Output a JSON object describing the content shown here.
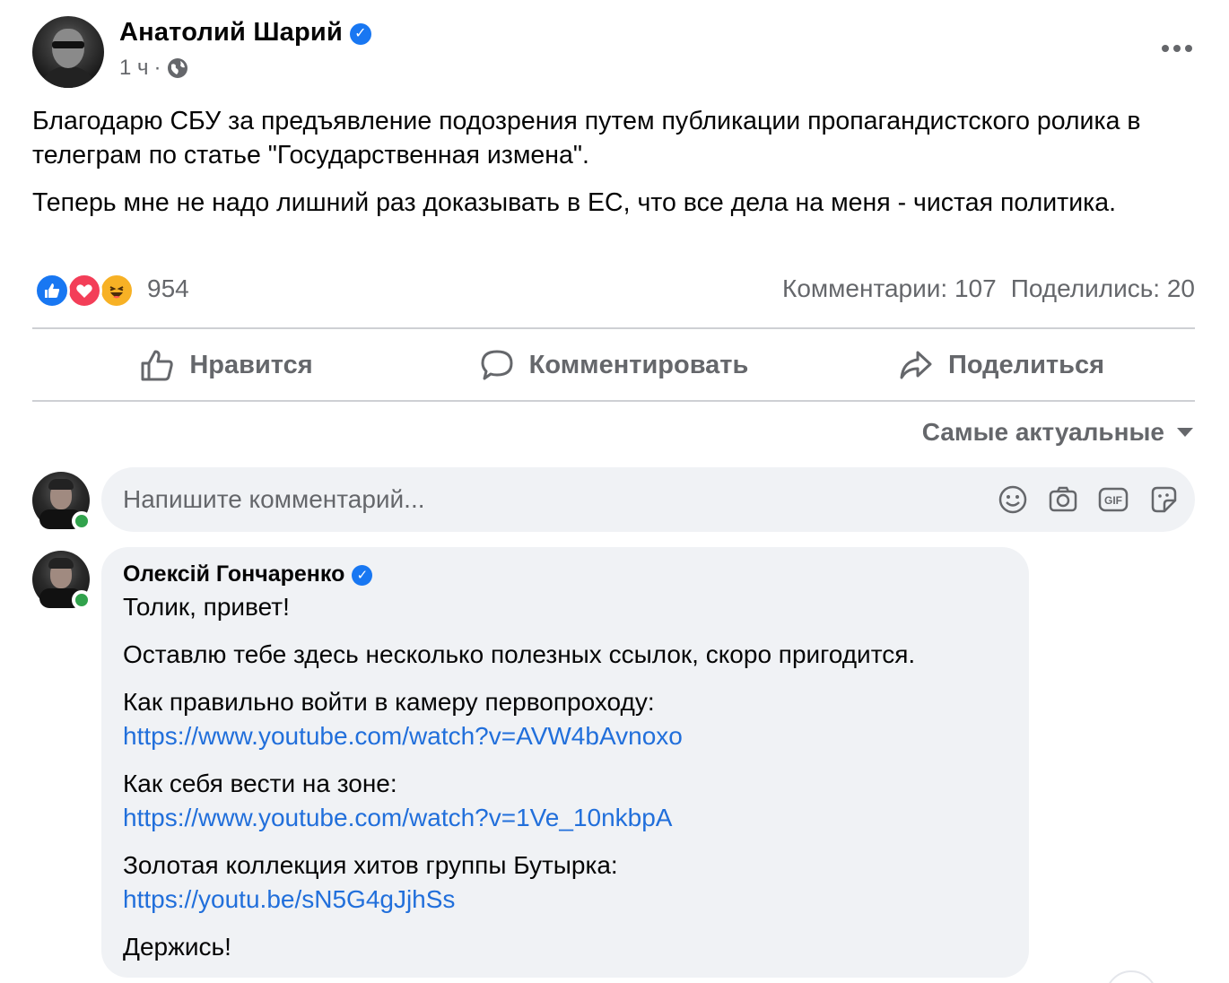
{
  "post": {
    "author": "Анатолий Шарий",
    "time": "1 ч",
    "separator": "·",
    "paragraphs": [
      "Благодарю СБУ за предъявление подозрения путем публикации пропагандистского ролика в телеграм по статье \"Государственная измена\".",
      "Теперь мне не надо лишний раз доказывать в ЕС, что все дела на меня - чистая политика."
    ],
    "reactions_count": "954",
    "comments_stat": "Комментарии: 107",
    "shares_stat": "Поделились: 20"
  },
  "actions": {
    "like": "Нравится",
    "comment": "Комментировать",
    "share": "Поделиться"
  },
  "sort": {
    "label": "Самые актуальные"
  },
  "comment_input": {
    "placeholder": "Напишите комментарий..."
  },
  "comment": {
    "author": "Олексій Гончаренко",
    "lines": {
      "greeting": "Толик, привет!",
      "intro": "Оставлю тебе здесь несколько полезных ссылок, скоро пригодится.",
      "q1": "Как правильно войти в камеру первопроходу:",
      "link1": "https://www.youtube.com/watch?v=AVW4bAvnoxo",
      "q2": "Как себя вести на зоне:",
      "link2": "https://www.youtube.com/watch?v=1Ve_10nkbpA",
      "q3": "Золотая коллекция хитов группы Бутырка:",
      "link3": "https://youtu.be/sN5G4gJjhSs",
      "bye": "Держись!"
    }
  },
  "colors": {
    "accent": "#1877f2",
    "link": "#216fdb",
    "secondary_text": "#65676b",
    "bubble_bg": "#f0f2f5",
    "online": "#31a24c"
  }
}
